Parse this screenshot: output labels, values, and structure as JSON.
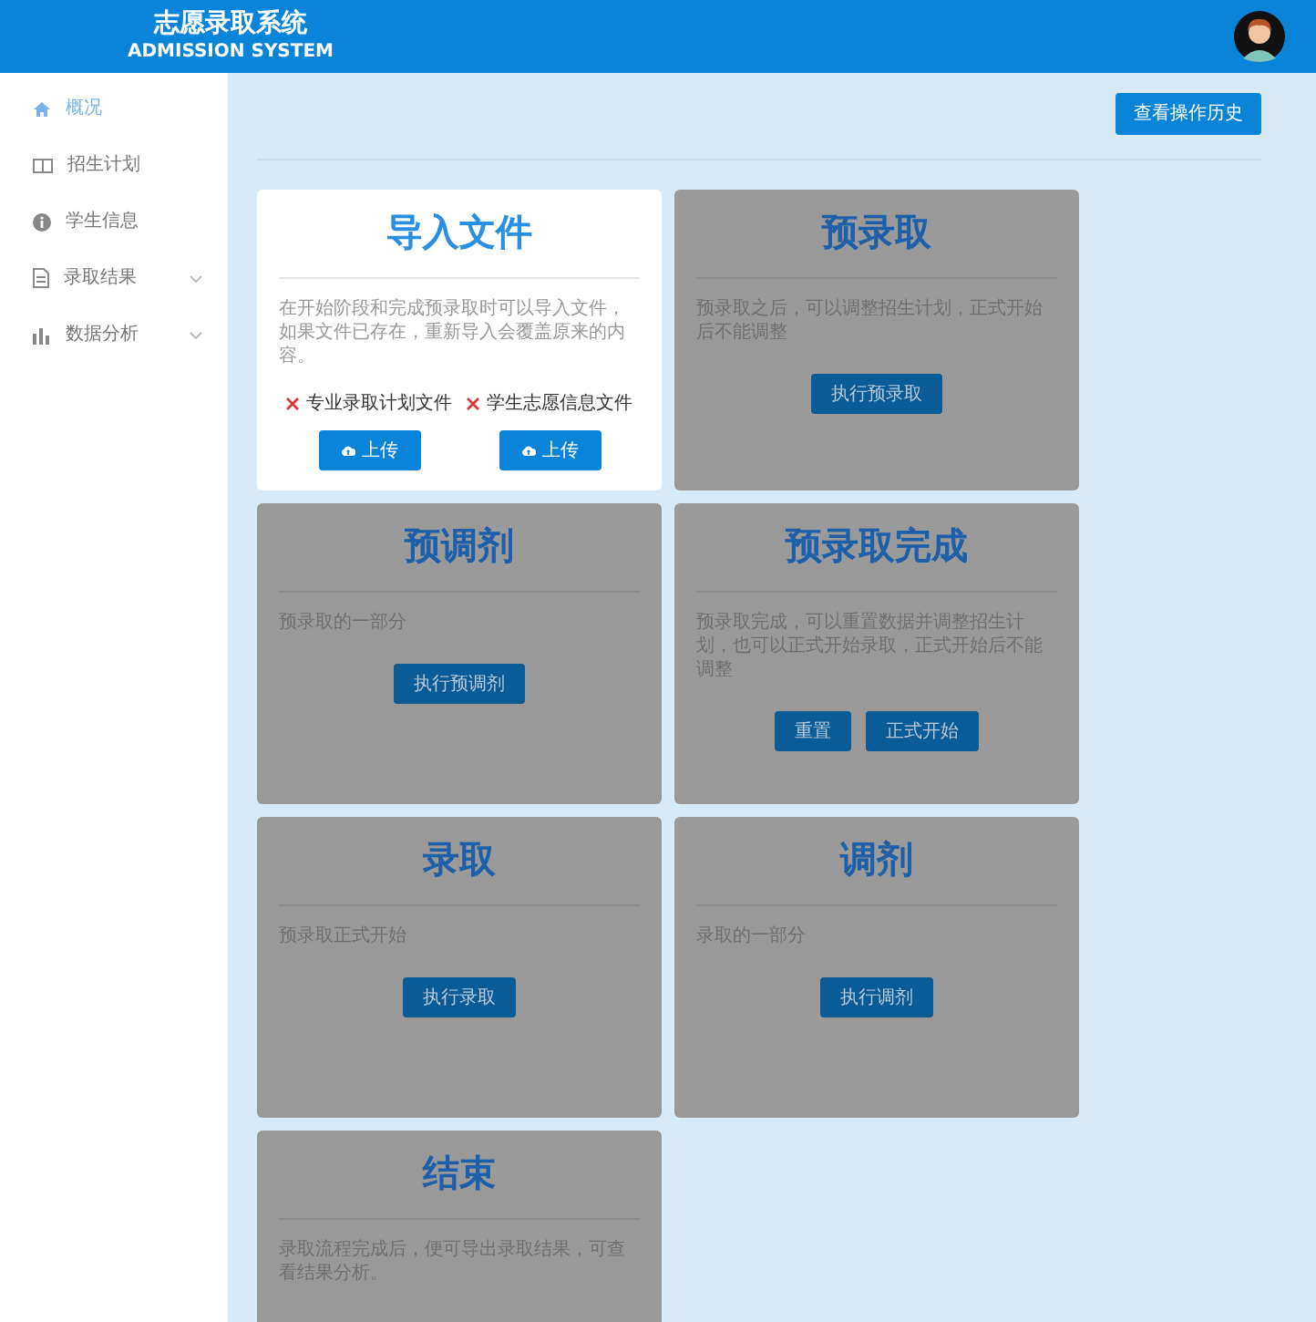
{
  "header": {
    "title": "志愿录取系统",
    "subtitle": "ADMISSION SYSTEM"
  },
  "sidebar": {
    "items": [
      {
        "label": "概况",
        "selected": true,
        "expandable": false
      },
      {
        "label": "招生计划",
        "selected": false,
        "expandable": false
      },
      {
        "label": "学生信息",
        "selected": false,
        "expandable": false
      },
      {
        "label": "录取结果",
        "selected": false,
        "expandable": true
      },
      {
        "label": "数据分析",
        "selected": false,
        "expandable": true
      }
    ]
  },
  "toolbar": {
    "history_button": "查看操作历史"
  },
  "cards": [
    {
      "kind": "import",
      "title": "导入文件",
      "disabled": false,
      "description": "在开始阶段和完成预录取时可以导入文件，如果文件已存在，重新导入会覆盖原来的内容。",
      "files": [
        {
          "label": "专业录取计划文件",
          "uploaded": false,
          "button": "上传"
        },
        {
          "label": "学生志愿信息文件",
          "uploaded": false,
          "button": "上传"
        }
      ]
    },
    {
      "kind": "step",
      "title": "预录取",
      "disabled": true,
      "description": "预录取之后，可以调整招生计划，正式开始后不能调整",
      "buttons": [
        "执行预录取"
      ]
    },
    {
      "kind": "step",
      "title": "预调剂",
      "disabled": true,
      "description": "预录取的一部分",
      "buttons": [
        "执行预调剂"
      ]
    },
    {
      "kind": "step",
      "title": "预录取完成",
      "disabled": true,
      "description": "预录取完成，可以重置数据并调整招生计划，也可以正式开始录取，正式开始后不能调整",
      "buttons": [
        "重置",
        "正式开始"
      ]
    },
    {
      "kind": "step",
      "title": "录取",
      "disabled": true,
      "description": "预录取正式开始",
      "buttons": [
        "执行录取"
      ]
    },
    {
      "kind": "step",
      "title": "调剂",
      "disabled": true,
      "description": "录取的一部分",
      "buttons": [
        "执行调剂"
      ]
    },
    {
      "kind": "step",
      "title": "结束",
      "disabled": true,
      "description": "录取流程完成后，便可导出录取结果，可查看结果分析。"
    }
  ]
}
